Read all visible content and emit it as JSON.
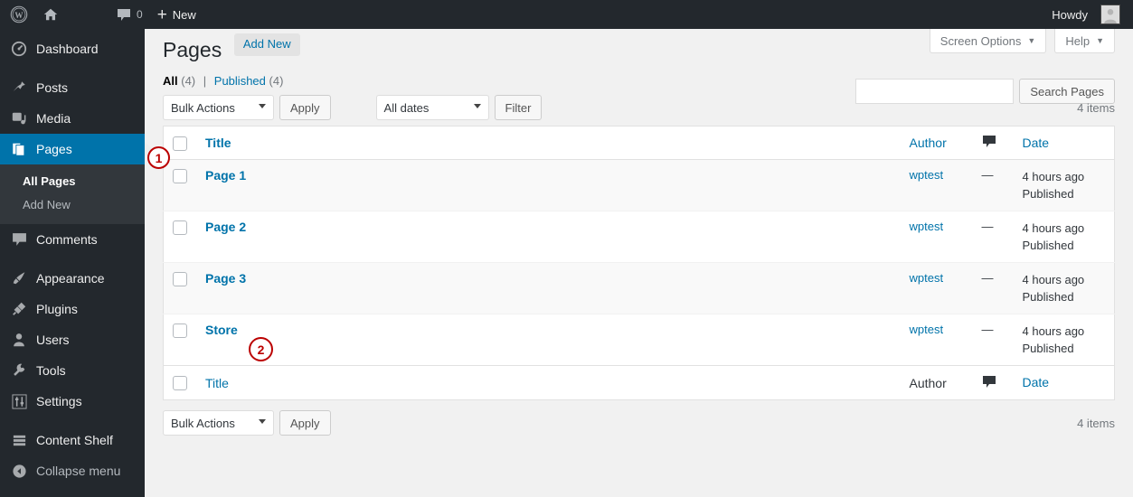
{
  "adminbar": {
    "wp_logo": "wordpress-logo",
    "site_home": "home-icon",
    "comments_icon": "comment-bubble-icon",
    "comments_count": "0",
    "new_plus": "+",
    "new_label": "New",
    "howdy": "Howdy",
    "avatar": "avatar"
  },
  "sidebar": {
    "items": [
      {
        "label": "Dashboard",
        "icon": "dashboard-gauge-icon",
        "current": false
      },
      {
        "label": "Posts",
        "icon": "pin-icon",
        "current": false
      },
      {
        "label": "Media",
        "icon": "media-icon",
        "current": false
      },
      {
        "label": "Pages",
        "icon": "pages-icon",
        "current": true
      },
      {
        "label": "Comments",
        "icon": "comment-bubble-icon",
        "current": false
      },
      {
        "label": "Appearance",
        "icon": "paintbrush-icon",
        "current": false
      },
      {
        "label": "Plugins",
        "icon": "plug-icon",
        "current": false
      },
      {
        "label": "Users",
        "icon": "user-icon",
        "current": false
      },
      {
        "label": "Tools",
        "icon": "wrench-icon",
        "current": false
      },
      {
        "label": "Settings",
        "icon": "sliders-icon",
        "current": false
      },
      {
        "label": "Content Shelf",
        "icon": "stacked-bars-icon",
        "current": false
      }
    ],
    "submenu": [
      {
        "label": "All Pages",
        "current": true
      },
      {
        "label": "Add New",
        "current": false
      }
    ],
    "collapse": {
      "label": "Collapse menu",
      "icon": "collapse-arrow-icon"
    }
  },
  "screen_meta": {
    "screen_options": "Screen Options",
    "help": "Help"
  },
  "header": {
    "title": "Pages",
    "add_new": "Add New"
  },
  "search": {
    "value": "",
    "placeholder": "",
    "button": "Search Pages"
  },
  "views": {
    "all_label": "All",
    "all_count": "(4)",
    "separator": "|",
    "published_label": "Published",
    "published_count": "(4)"
  },
  "tablenav_top": {
    "bulk_actions": "Bulk Actions",
    "apply": "Apply",
    "all_dates": "All dates",
    "filter": "Filter",
    "items": "4 items"
  },
  "tablenav_bottom": {
    "bulk_actions": "Bulk Actions",
    "apply": "Apply",
    "items": "4 items"
  },
  "table": {
    "columns": {
      "title": "Title",
      "author": "Author",
      "comments": "comment-bubble-icon",
      "date": "Date"
    },
    "rows": [
      {
        "title": "Page 1",
        "author": "wptest",
        "comments": "—",
        "date_rel": "4 hours ago",
        "date_status": "Published"
      },
      {
        "title": "Page 2",
        "author": "wptest",
        "comments": "—",
        "date_rel": "4 hours ago",
        "date_status": "Published"
      },
      {
        "title": "Page 3",
        "author": "wptest",
        "comments": "—",
        "date_rel": "4 hours ago",
        "date_status": "Published"
      },
      {
        "title": "Store",
        "author": "wptest",
        "comments": "—",
        "date_rel": "4 hours ago",
        "date_status": "Published"
      }
    ]
  },
  "annotations": [
    {
      "label": "1"
    },
    {
      "label": "2"
    }
  ],
  "colors": {
    "admin_dark": "#23282d",
    "submenu_dark": "#32373c",
    "accent_blue": "#0073aa",
    "link_blue": "#0073aa",
    "page_bg": "#f1f1f1",
    "annotation_red": "#bb0000"
  }
}
